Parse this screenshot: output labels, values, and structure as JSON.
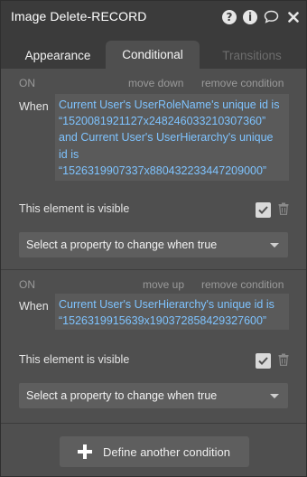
{
  "header": {
    "title": "Image Delete-RECORD",
    "icons": [
      "help-icon",
      "info-icon",
      "comment-icon",
      "close-icon"
    ]
  },
  "tabs": [
    {
      "label": "Appearance",
      "state": "normal"
    },
    {
      "label": "Conditional",
      "state": "active"
    },
    {
      "label": "Transitions",
      "state": "disabled"
    }
  ],
  "conditions": [
    {
      "on_label": "ON",
      "actions": [
        "move down",
        "remove condition"
      ],
      "when_label": "When",
      "expression_lines": [
        "Current User's UserRoleName's unique id is",
        "“1520081921127x248246033210307360”",
        "and Current User's UserHierarchy's unique",
        "id is",
        "“1526319907337x880432233447209000”"
      ],
      "property_label": "This element is visible",
      "property_checked": true,
      "select_text": "Select a property to change when true"
    },
    {
      "on_label": "ON",
      "actions": [
        "move up",
        "remove condition"
      ],
      "when_label": "When",
      "expression_lines": [
        "Current User's UserHierarchy's unique id is",
        "“1526319915639x190372858429327600”"
      ],
      "property_label": "This element is visible",
      "property_checked": true,
      "select_text": "Select a property to change when true"
    }
  ],
  "footer": {
    "define_label": "Define another condition"
  },
  "colors": {
    "panel_bg": "#4f4f4f",
    "header_bg": "#3b3b3b",
    "expression_text": "#7ec3ff",
    "field_bg": "#5e5e5e"
  }
}
